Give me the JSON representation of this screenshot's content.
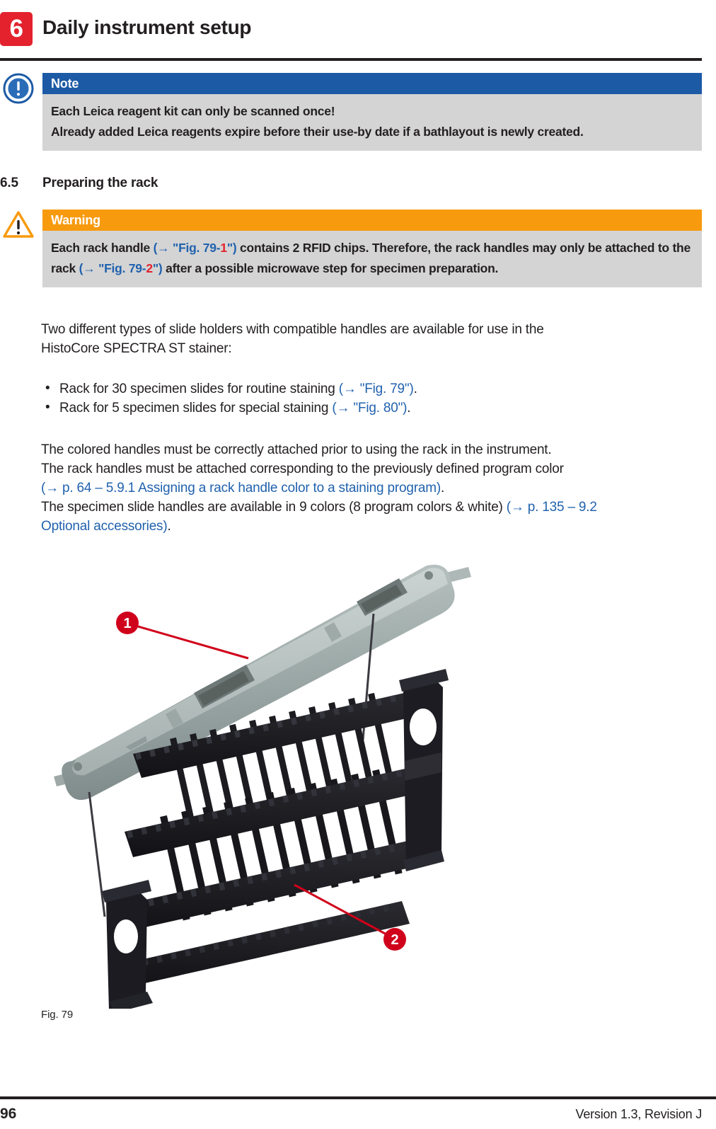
{
  "header": {
    "chapter_number": "6",
    "title": "Daily instrument setup"
  },
  "note_box": {
    "icon": "info-circle-icon",
    "label": "Note",
    "header_color": "#1d5aa5",
    "body_color": "#d4d4d4",
    "lines": [
      "Each Leica reagent kit can only be scanned once!",
      "Already added Leica reagents expire before their use-by date if a bathlayout is newly created."
    ]
  },
  "section": {
    "number": "6.5",
    "title": "Preparing the rack"
  },
  "warning_box": {
    "icon": "warning-triangle-icon",
    "label": "Warning",
    "header_color": "#f89a0e",
    "body_color": "#d4d4d4",
    "text_part_1": "Each rack handle ",
    "xref_1_open": "(→ \"Fig. 79-",
    "xref_1_num": "1",
    "xref_1_close": "\")",
    "text_part_2": " contains 2 RFID chips. Therefore, the rack handles may only be attached to the rack ",
    "xref_2_open": "(→ \"Fig. 79-",
    "xref_2_num": "2",
    "xref_2_close": "\")",
    "text_part_3": " after a possible microwave step for specimen preparation."
  },
  "intro_paragraph": {
    "line_1": "Two different types of slide holders with compatible handles are available for use in the",
    "line_2": "HistoCore SPECTRA ST stainer:"
  },
  "bullets": [
    {
      "text": "Rack for 30 specimen slides for routine staining ",
      "xref": "(→ \"Fig. 79\")",
      "suffix": "."
    },
    {
      "text": "Rack for 5 specimen slides for special staining ",
      "xref": "(→ \"Fig. 80\")",
      "suffix": "."
    }
  ],
  "colors_paragraph": {
    "line_1": "The colored handles must be correctly attached prior to using the rack in the instrument.",
    "line_2": "The rack handles must be attached corresponding to the previously defined program color",
    "line_3_xref": "(→ p. 64 – 5.9.1 Assigning a rack handle color to a staining program)",
    "line_3_suffix": ".",
    "line_4a": "The specimen slide handles are available in 9 colors (8 program colors & white) ",
    "line_4_xref": "(→ p. 135 – 9.2",
    "line_5_xref": "Optional accessories)",
    "line_5_suffix": "."
  },
  "figure": {
    "caption": "Fig. 79",
    "callout_color": "#d0021b",
    "callouts": [
      {
        "number": "1",
        "target": "rack-handle"
      },
      {
        "number": "2",
        "target": "slide-rack"
      }
    ],
    "handle_color": "#9aa6a4",
    "rack_color": "#18181c"
  },
  "footer": {
    "page_number": "96",
    "version": "Version 1.3, Revision J"
  }
}
